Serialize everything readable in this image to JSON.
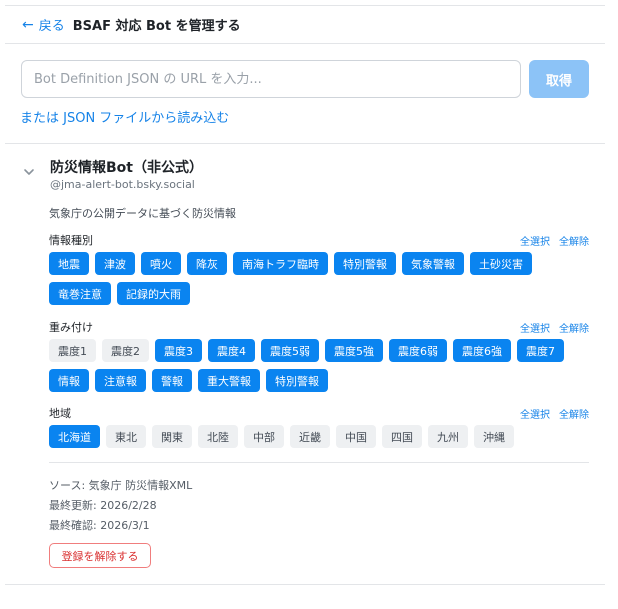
{
  "header": {
    "back_label": "戻る",
    "title": "BSAF 対応 Bot を管理する"
  },
  "url_form": {
    "placeholder": "Bot Definition JSON の URL を入力...",
    "value": "",
    "fetch_label": "取得",
    "file_link": "または JSON ファイルから読み込む"
  },
  "bot": {
    "name": "防災情報Bot（非公式）",
    "handle": "@jma-alert-bot.bsky.social",
    "description": "気象庁の公開データに基づく防災情報",
    "sections": [
      {
        "title": "情報種別",
        "select_all": "全選択",
        "deselect_all": "全解除",
        "chips": [
          {
            "label": "地震",
            "selected": true
          },
          {
            "label": "津波",
            "selected": true
          },
          {
            "label": "噴火",
            "selected": true
          },
          {
            "label": "降灰",
            "selected": true
          },
          {
            "label": "南海トラフ臨時",
            "selected": true
          },
          {
            "label": "特別警報",
            "selected": true
          },
          {
            "label": "気象警報",
            "selected": true
          },
          {
            "label": "土砂災害",
            "selected": true
          },
          {
            "label": "竜巻注意",
            "selected": true
          },
          {
            "label": "記録的大雨",
            "selected": true
          }
        ]
      },
      {
        "title": "重み付け",
        "select_all": "全選択",
        "deselect_all": "全解除",
        "chips": [
          {
            "label": "震度1",
            "selected": false
          },
          {
            "label": "震度2",
            "selected": false
          },
          {
            "label": "震度3",
            "selected": true
          },
          {
            "label": "震度4",
            "selected": true
          },
          {
            "label": "震度5弱",
            "selected": true
          },
          {
            "label": "震度5強",
            "selected": true
          },
          {
            "label": "震度6弱",
            "selected": true
          },
          {
            "label": "震度6強",
            "selected": true
          },
          {
            "label": "震度7",
            "selected": true
          },
          {
            "label": "情報",
            "selected": true
          },
          {
            "label": "注意報",
            "selected": true
          },
          {
            "label": "警報",
            "selected": true
          },
          {
            "label": "重大警報",
            "selected": true
          },
          {
            "label": "特別警報",
            "selected": true
          }
        ]
      },
      {
        "title": "地域",
        "select_all": "全選択",
        "deselect_all": "全解除",
        "chips": [
          {
            "label": "北海道",
            "selected": true
          },
          {
            "label": "東北",
            "selected": false
          },
          {
            "label": "関東",
            "selected": false
          },
          {
            "label": "北陸",
            "selected": false
          },
          {
            "label": "中部",
            "selected": false
          },
          {
            "label": "近畿",
            "selected": false
          },
          {
            "label": "中国",
            "selected": false
          },
          {
            "label": "四国",
            "selected": false
          },
          {
            "label": "九州",
            "selected": false
          },
          {
            "label": "沖縄",
            "selected": false
          }
        ]
      }
    ],
    "meta": {
      "source": "ソース: 気象庁 防災情報XML",
      "last_updated": "最終更新: 2026/2/28",
      "last_checked": "最終確認: 2026/3/1"
    },
    "unregister_label": "登録を解除する"
  },
  "colors": {
    "accent": "#0a84f0",
    "link": "#1683e8",
    "danger": "#d93030",
    "fetch_disabled": "#8cc3f7"
  }
}
